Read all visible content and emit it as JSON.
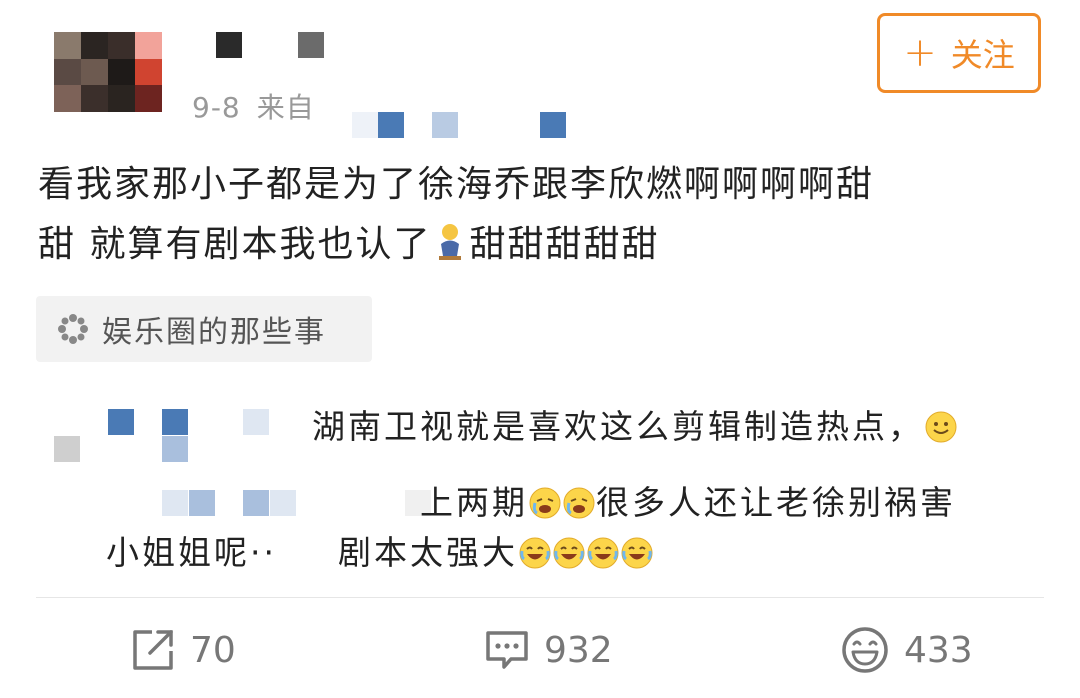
{
  "post": {
    "date": "9-8",
    "source_label": "来自",
    "follow_label": "关注",
    "text_line1": "看我家那小子都是为了徐海乔跟李欣燃啊啊啊啊甜",
    "text_line2_a": "甜 就算有剧本我也认了",
    "text_line2_b": "甜甜甜甜甜",
    "topic": "娱乐圈的那些事"
  },
  "forward": {
    "line1": "湖南卫视就是喜欢这么剪辑制造热点，",
    "line2_a": "上两期",
    "line2_b": "很多人还让老徐别祸害",
    "line3_left": "小姐姐呢··",
    "line3_right": "剧本太强大"
  },
  "actions": {
    "repost_count": "70",
    "comment_count": "932",
    "like_count": "433"
  },
  "colors": {
    "accent": "#f08a28",
    "mosaic_blue": "#4a7ab5",
    "text_gray": "#999999"
  }
}
